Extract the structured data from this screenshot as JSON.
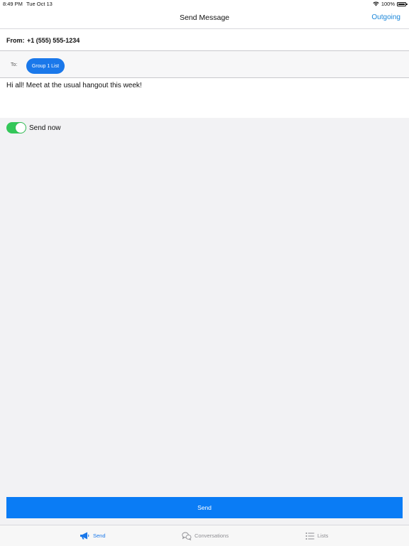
{
  "status_bar": {
    "time": "8:49 PM",
    "date": "Tue Oct 13",
    "battery": "100%",
    "icons": [
      "wifi-icon",
      "battery-icon"
    ]
  },
  "nav": {
    "title": "Send Message",
    "right_action": "Outgoing"
  },
  "from": {
    "label": "From:",
    "value": "+1 (555) 555-1234"
  },
  "to": {
    "label": "To:",
    "chips": [
      "Group 1 List"
    ]
  },
  "message": {
    "text": "Hi all! Meet at the usual hangout this week!"
  },
  "send_now": {
    "label": "Send now",
    "on": true
  },
  "send_button": {
    "label": "Send"
  },
  "tabs": [
    {
      "label": "Send",
      "icon": "megaphone-icon",
      "active": true
    },
    {
      "label": "Conversations",
      "icon": "chat-bubbles-icon",
      "active": false
    },
    {
      "label": "Lists",
      "icon": "list-icon",
      "active": false
    }
  ],
  "colors": {
    "accent": "#1a78ea",
    "toggle_on": "#34c759",
    "send_button": "#0a7cf5",
    "inactive_tab": "#8e8e93"
  }
}
